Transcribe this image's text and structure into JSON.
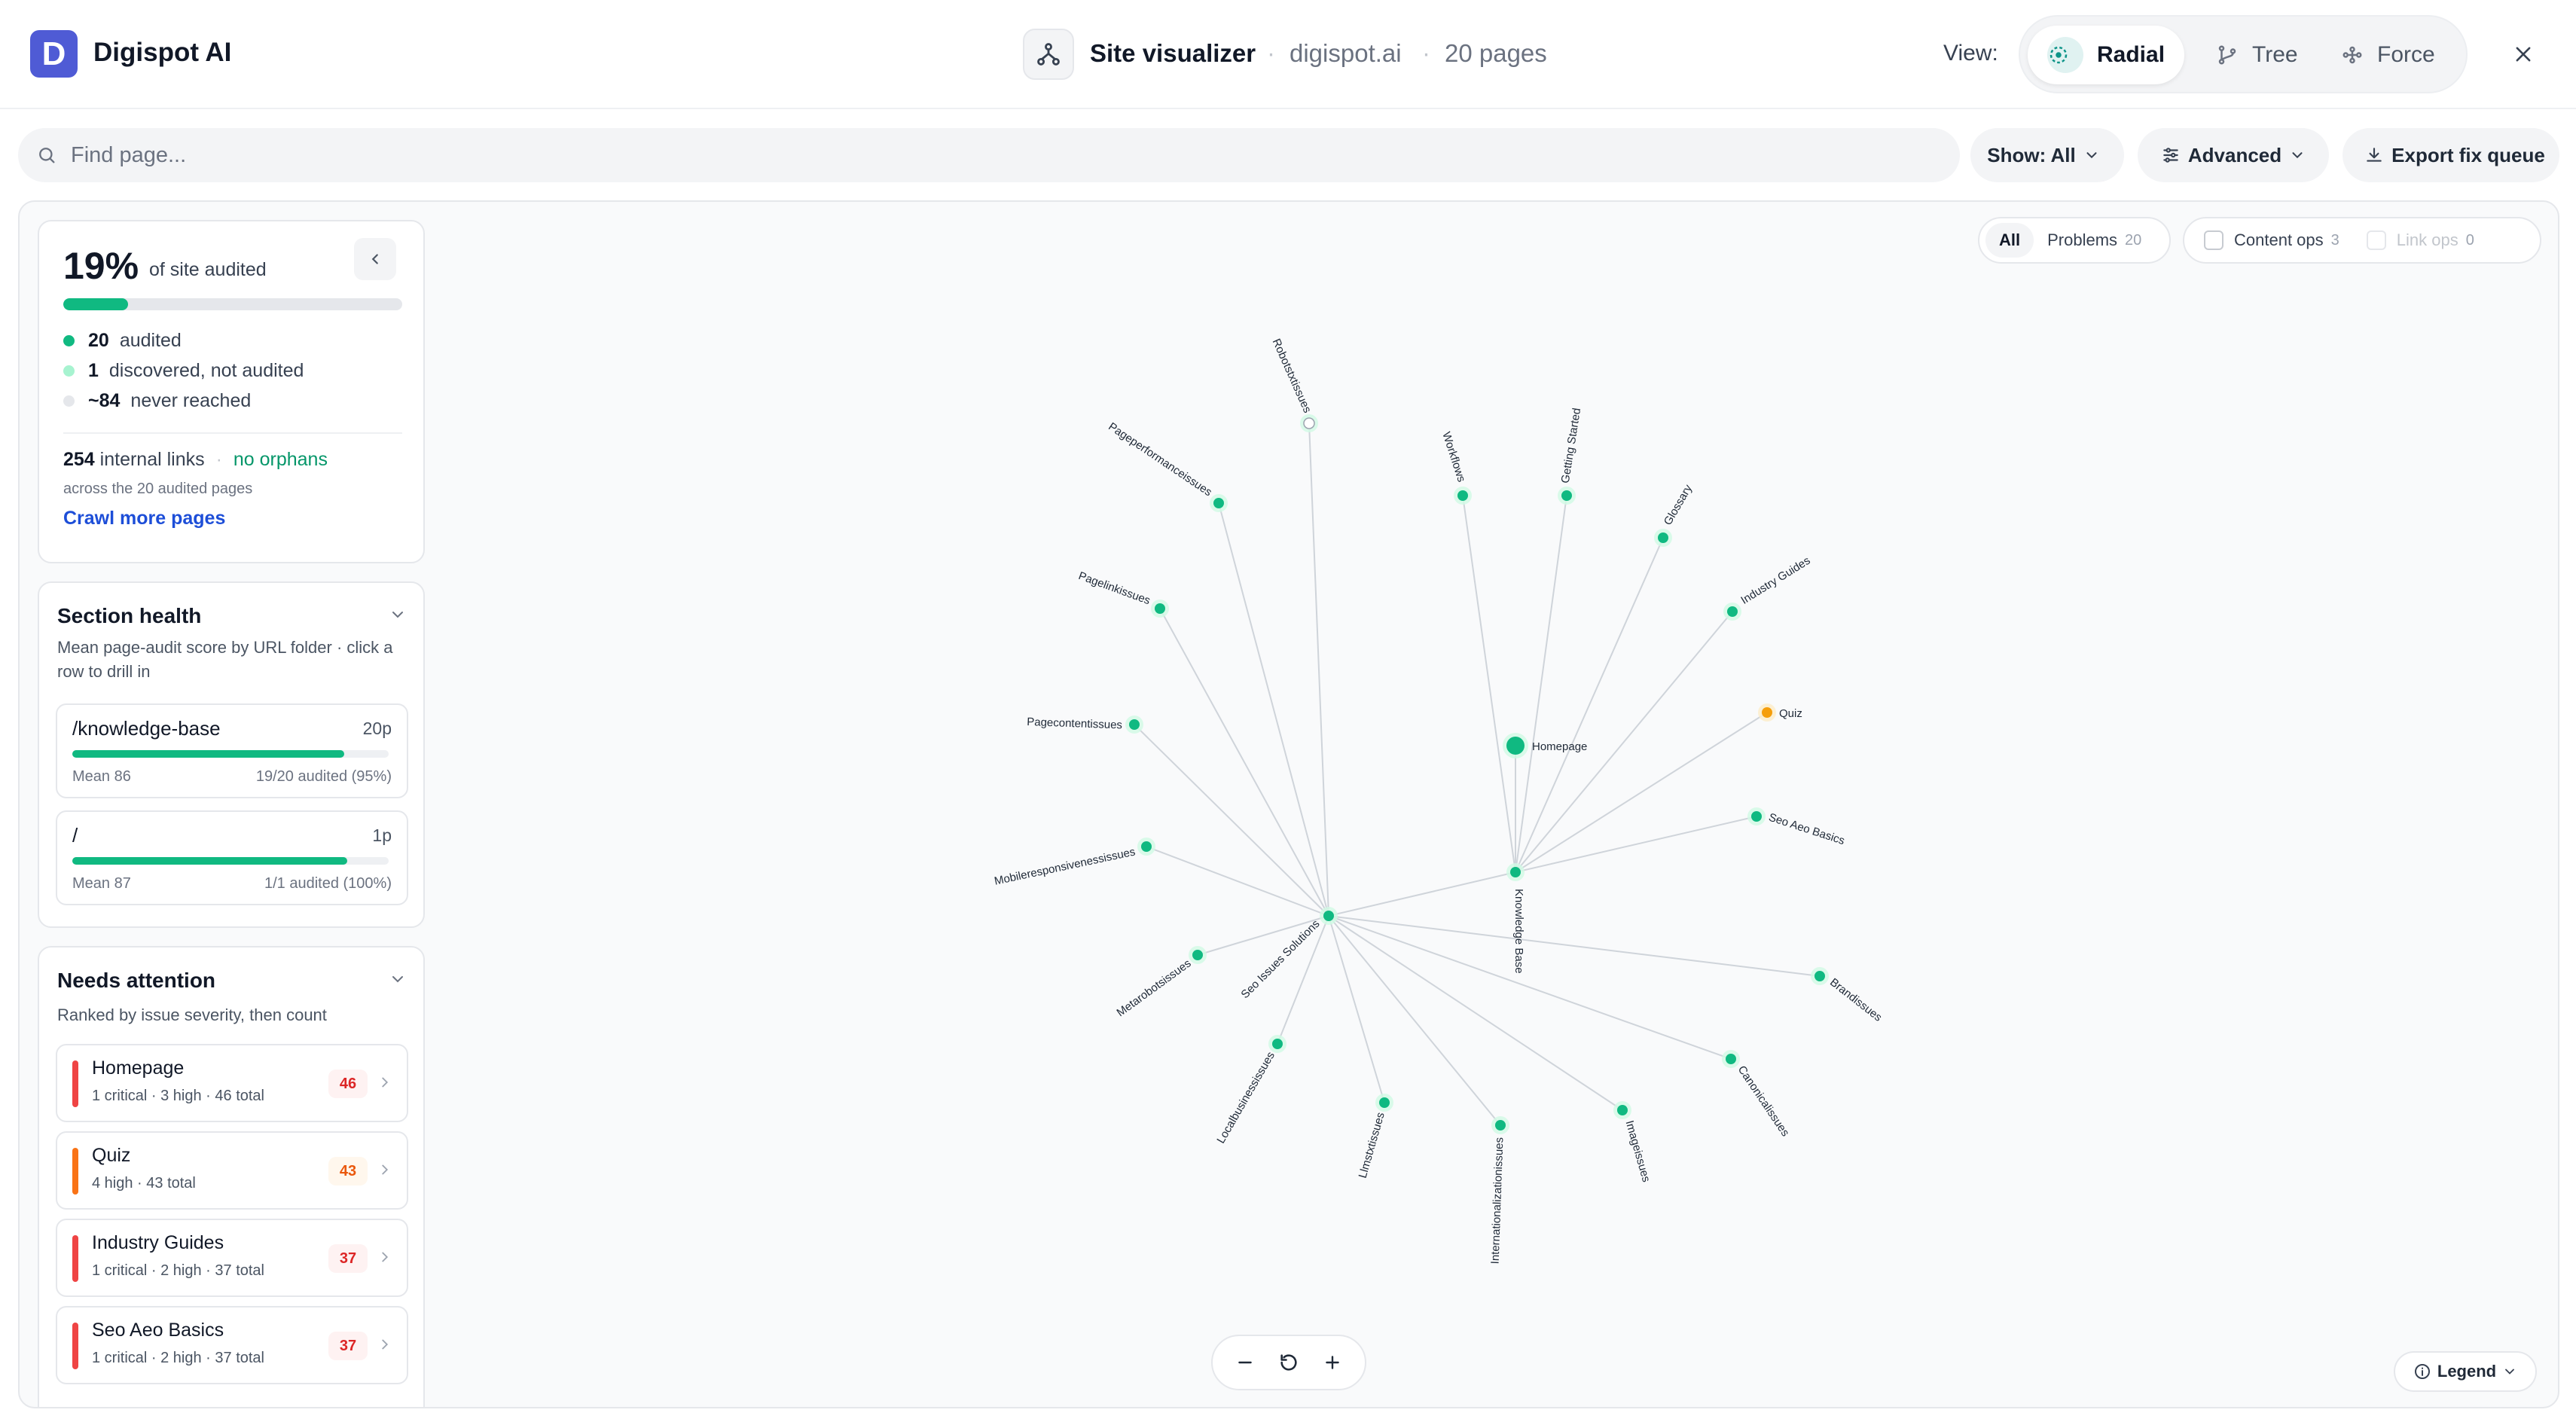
{
  "app": {
    "logo_letter": "D",
    "name": "Digispot AI"
  },
  "header": {
    "title": "Site visualizer",
    "domain": "digispot.ai",
    "pages": "20 pages",
    "separator": "·",
    "view_label": "View:",
    "views": [
      {
        "label": "Radial",
        "active": true,
        "icon": "radial-icon"
      },
      {
        "label": "Tree",
        "active": false,
        "icon": "tree-icon"
      },
      {
        "label": "Force",
        "active": false,
        "icon": "force-icon"
      }
    ]
  },
  "toolbar": {
    "search_placeholder": "Find page...",
    "show_label": "Show: All",
    "advanced_label": "Advanced",
    "export_label": "Export fix queue"
  },
  "summary": {
    "percent": "19%",
    "percent_label": "of site audited",
    "progress": 0.19,
    "audited_count": "20",
    "audited_label": "audited",
    "discovered_count": "1",
    "discovered_label": "discovered, not audited",
    "never_count": "~84",
    "never_label": "never reached",
    "links_count": "254",
    "links_label": "internal links",
    "orphans": "no orphans",
    "links_sub": "across the 20 audited pages",
    "crawl_link": "Crawl more pages"
  },
  "section_health": {
    "title": "Section health",
    "description": "Mean page-audit score by URL folder · click a row to drill in",
    "rows": [
      {
        "name": "/knowledge-base",
        "count": "20p",
        "score": 86,
        "mean": "Mean 86",
        "audited": "19/20 audited (95%)"
      },
      {
        "name": "/",
        "count": "1p",
        "score": 87,
        "mean": "Mean 87",
        "audited": "1/1 audited (100%)"
      }
    ]
  },
  "needs_attention": {
    "title": "Needs attention",
    "description": "Ranked by issue severity, then count",
    "items": [
      {
        "name": "Homepage",
        "detail": "1 critical · 3 high · 46 total",
        "count": "46",
        "severity": "critical"
      },
      {
        "name": "Quiz",
        "detail": "4 high · 43 total",
        "count": "43",
        "severity": "high"
      },
      {
        "name": "Industry Guides",
        "detail": "1 critical · 2 high · 37 total",
        "count": "37",
        "severity": "critical"
      },
      {
        "name": "Seo Aeo Basics",
        "detail": "1 critical · 2 high · 37 total",
        "count": "37",
        "severity": "critical"
      }
    ]
  },
  "filters": {
    "all": "All",
    "problems": "Problems",
    "problems_count": "20",
    "content_ops": "Content ops",
    "content_ops_count": "3",
    "link_ops": "Link ops",
    "link_ops_count": "0"
  },
  "graph": {
    "hubs": [
      "Homepage",
      "Knowledge Base",
      "Seo Issues Solutions"
    ],
    "nodes": [
      {
        "label": "Homepage",
        "status": "audited"
      },
      {
        "label": "Knowledge Base",
        "status": "audited"
      },
      {
        "label": "Seo Issues Solutions",
        "status": "audited"
      },
      {
        "label": "Workflows",
        "status": "audited"
      },
      {
        "label": "Getting Started",
        "status": "audited"
      },
      {
        "label": "Glossary",
        "status": "audited"
      },
      {
        "label": "Industry Guides",
        "status": "audited"
      },
      {
        "label": "Quiz",
        "status": "warning"
      },
      {
        "label": "Seo Aeo Basics",
        "status": "audited"
      },
      {
        "label": "Robotstxtissues",
        "status": "discovered"
      },
      {
        "label": "Pageperformanceissues",
        "status": "audited"
      },
      {
        "label": "Pagelinkissues",
        "status": "audited"
      },
      {
        "label": "Pagecontentissues",
        "status": "audited"
      },
      {
        "label": "Mobileresponsivenessissues",
        "status": "audited"
      },
      {
        "label": "Metarobotsissues",
        "status": "audited"
      },
      {
        "label": "Localbusinessissues",
        "status": "audited"
      },
      {
        "label": "Llmstxtissues",
        "status": "audited"
      },
      {
        "label": "Internationalizationissues",
        "status": "audited"
      },
      {
        "label": "Imageissues",
        "status": "audited"
      },
      {
        "label": "Canonicalissues",
        "status": "audited"
      },
      {
        "label": "Brandissues",
        "status": "audited"
      }
    ]
  },
  "colors": {
    "accent": "#4f5bd5",
    "audited": "#10b981",
    "discovered": "#a7f3d0",
    "never": "#e5e7eb",
    "critical": "#ef4444",
    "high": "#f97316",
    "warning_node": "#f59e0b",
    "link": "#1d4ed8"
  },
  "controls": {
    "legend": "Legend"
  }
}
